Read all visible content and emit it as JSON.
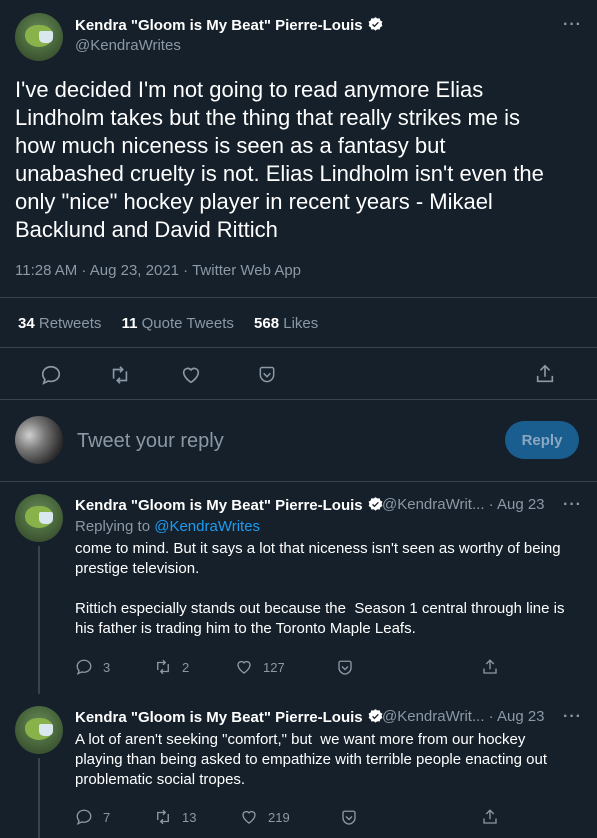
{
  "main_tweet": {
    "author_name": "Kendra \"Gloom is My Beat\" Pierre-Louis",
    "handle": "@KendraWrites",
    "text": "I've decided I'm not going to read anymore Elias\nLindholm takes but the thing that really strikes me is\nhow much niceness is seen as a fantasy but\nunabashed cruelty is not. Elias Lindholm isn't even the\nonly \"nice\" hockey player in recent years - Mikael\nBacklund and David Rittich",
    "meta": "11:28 AM · Aug 23, 2021 · Twitter Web App",
    "stats": {
      "retweets_count": "34",
      "retweets_label": "Retweets",
      "quotes_count": "11",
      "quotes_label": "Quote Tweets",
      "likes_count": "568",
      "likes_label": "Likes"
    }
  },
  "composer": {
    "placeholder": "Tweet your reply",
    "button_label": "Reply"
  },
  "replies": [
    {
      "author_name": "Kendra \"Gloom is My Beat\" Pierre-Louis",
      "handle_date": "@KendraWrit... · Aug 23",
      "replying_to_label": "Replying to",
      "replying_to_handle": "@KendraWrites",
      "text": "come to mind. But it says a lot that niceness isn't seen as worthy of being\nprestige television.\n\nRittich especially stands out because the  Season 1 central through line is\nhis father is trading him to the Toronto Maple Leafs.",
      "replies": "3",
      "retweets": "2",
      "likes": "127"
    },
    {
      "author_name": "Kendra \"Gloom is My Beat\" Pierre-Louis",
      "handle_date": "@KendraWrit... · Aug 23",
      "text": "A lot of aren't seeking \"comfort,\" but  we want more from our hockey\nplaying than being asked to empathize with terrible people enacting out\nproblematic social tropes.",
      "replies": "7",
      "retweets": "13",
      "likes": "219"
    }
  ],
  "icons": {
    "verified": "verified-badge-icon",
    "more": "more-icon",
    "reply": "reply-icon",
    "retweet": "retweet-icon",
    "like": "heart-icon",
    "bookmark": "bookmark-icon",
    "share": "share-icon"
  },
  "colors": {
    "background": "#15202b",
    "accent": "#1d9bf0",
    "muted": "#8b98a5",
    "divider": "#38444d"
  }
}
